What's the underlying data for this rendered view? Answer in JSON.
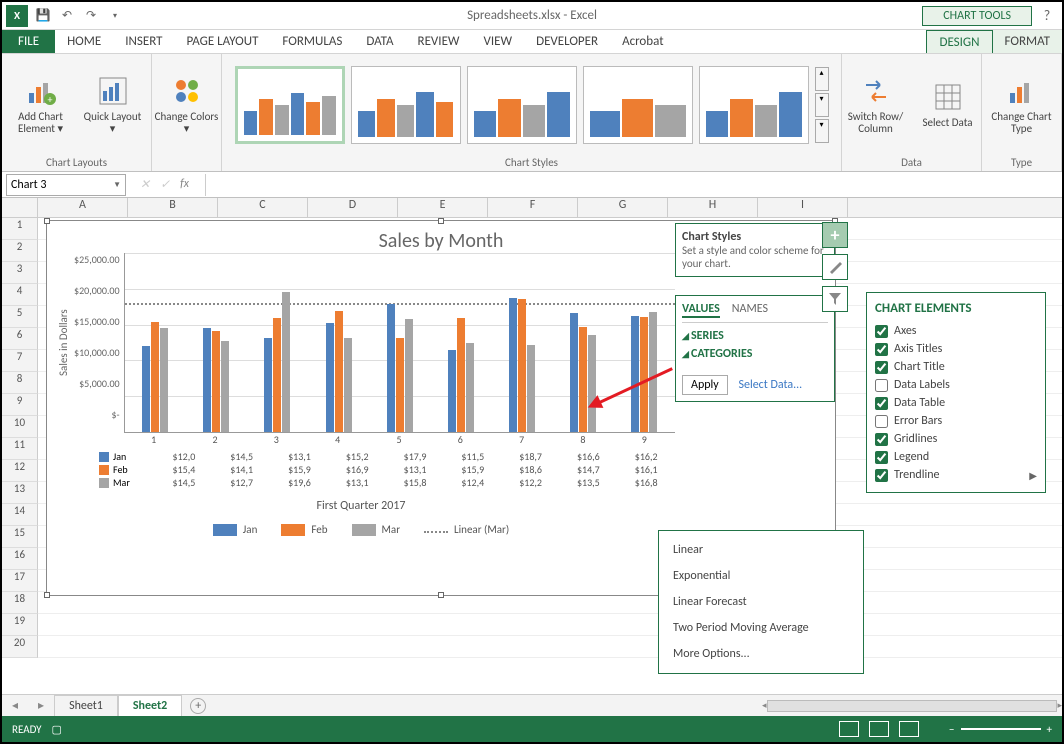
{
  "titlebar": {
    "title": "Spreadsheets.xlsx - Excel",
    "chart_tools": "CHART TOOLS",
    "help": "?"
  },
  "tabs": {
    "file": "FILE",
    "home": "HOME",
    "insert": "INSERT",
    "pagelayout": "PAGE LAYOUT",
    "formulas": "FORMULAS",
    "data": "DATA",
    "review": "REVIEW",
    "view": "VIEW",
    "developer": "DEVELOPER",
    "acrobat": "Acrobat",
    "design": "DESIGN",
    "format": "FORMAT"
  },
  "ribbon": {
    "add_chart_element": "Add Chart Element ▾",
    "quick_layout": "Quick Layout ▾",
    "change_colors": "Change Colors ▾",
    "group_chart_layouts": "Chart Layouts",
    "group_chart_styles": "Chart Styles",
    "switch_rowcol": "Switch Row/ Column",
    "select_data": "Select Data",
    "group_data": "Data",
    "change_chart_type": "Change Chart Type",
    "group_type": "Type"
  },
  "namebox": "Chart 3",
  "fx_label": "fx",
  "columns": [
    "A",
    "B",
    "C",
    "D",
    "E",
    "F",
    "G",
    "H",
    "I"
  ],
  "chart": {
    "title": "Sales by Month",
    "yaxis_title": "Sales in Dollars",
    "xaxis_title": "First Quarter 2017",
    "yticks": [
      "$25,000.00",
      "$20,000.00",
      "$15,000.00",
      "$10,000.00",
      "$5,000.00",
      "$-"
    ],
    "xcats": [
      "1",
      "2",
      "3",
      "4",
      "5",
      "6",
      "7",
      "8",
      "9"
    ],
    "series": {
      "jan": "Jan",
      "feb": "Feb",
      "mar": "Mar",
      "trend": "Linear (Mar)"
    },
    "table": {
      "jan": [
        "$12,0",
        "$14,5",
        "$13,1",
        "$15,2",
        "$17,9",
        "$11,5",
        "$18,7",
        "$16,6",
        "$16,2"
      ],
      "feb": [
        "$15,4",
        "$14,1",
        "$15,9",
        "$16,9",
        "$13,1",
        "$15,9",
        "$18,6",
        "$14,7",
        "$16,1"
      ],
      "mar": [
        "$14,5",
        "$12,7",
        "$19,6",
        "$13,1",
        "$15,8",
        "$12,4",
        "$12,2",
        "$13,5",
        "$16,8"
      ]
    }
  },
  "chart_data": {
    "type": "bar",
    "title": "Sales by Month",
    "xlabel": "First Quarter 2017",
    "ylabel": "Sales in Dollars",
    "ylim": [
      0,
      25000
    ],
    "categories": [
      "1",
      "2",
      "3",
      "4",
      "5",
      "6",
      "7",
      "8",
      "9"
    ],
    "series": [
      {
        "name": "Jan",
        "values": [
          12000,
          14500,
          13100,
          15200,
          17900,
          11500,
          18700,
          16600,
          16200
        ]
      },
      {
        "name": "Feb",
        "values": [
          15400,
          14100,
          15900,
          16900,
          13100,
          15900,
          18600,
          14700,
          16100
        ]
      },
      {
        "name": "Mar",
        "values": [
          14500,
          12700,
          19600,
          13100,
          15800,
          12400,
          12200,
          13500,
          16800
        ]
      }
    ],
    "trendline": "Linear (Mar)"
  },
  "taskpane_styles": {
    "title": "Chart Styles",
    "sub": "Set a style and color scheme for your chart."
  },
  "taskpane_values": {
    "tab_values": "VALUES",
    "tab_names": "NAMES",
    "item_series": "SERIES",
    "item_categories": "CATEGORIES",
    "apply": "Apply",
    "select_data": "Select Data..."
  },
  "chart_elements": {
    "title": "CHART ELEMENTS",
    "items": [
      {
        "label": "Axes",
        "checked": true
      },
      {
        "label": "Axis Titles",
        "checked": true
      },
      {
        "label": "Chart Title",
        "checked": true
      },
      {
        "label": "Data Labels",
        "checked": false
      },
      {
        "label": "Data Table",
        "checked": true
      },
      {
        "label": "Error Bars",
        "checked": false
      },
      {
        "label": "Gridlines",
        "checked": true
      },
      {
        "label": "Legend",
        "checked": true
      },
      {
        "label": "Trendline",
        "checked": true,
        "sub": true
      }
    ]
  },
  "trendline_sub": [
    "Linear",
    "Exponential",
    "Linear Forecast",
    "Two Period Moving Average",
    "More Options..."
  ],
  "sheets": {
    "s1": "Sheet1",
    "s2": "Sheet2"
  },
  "status": {
    "ready": "READY"
  }
}
